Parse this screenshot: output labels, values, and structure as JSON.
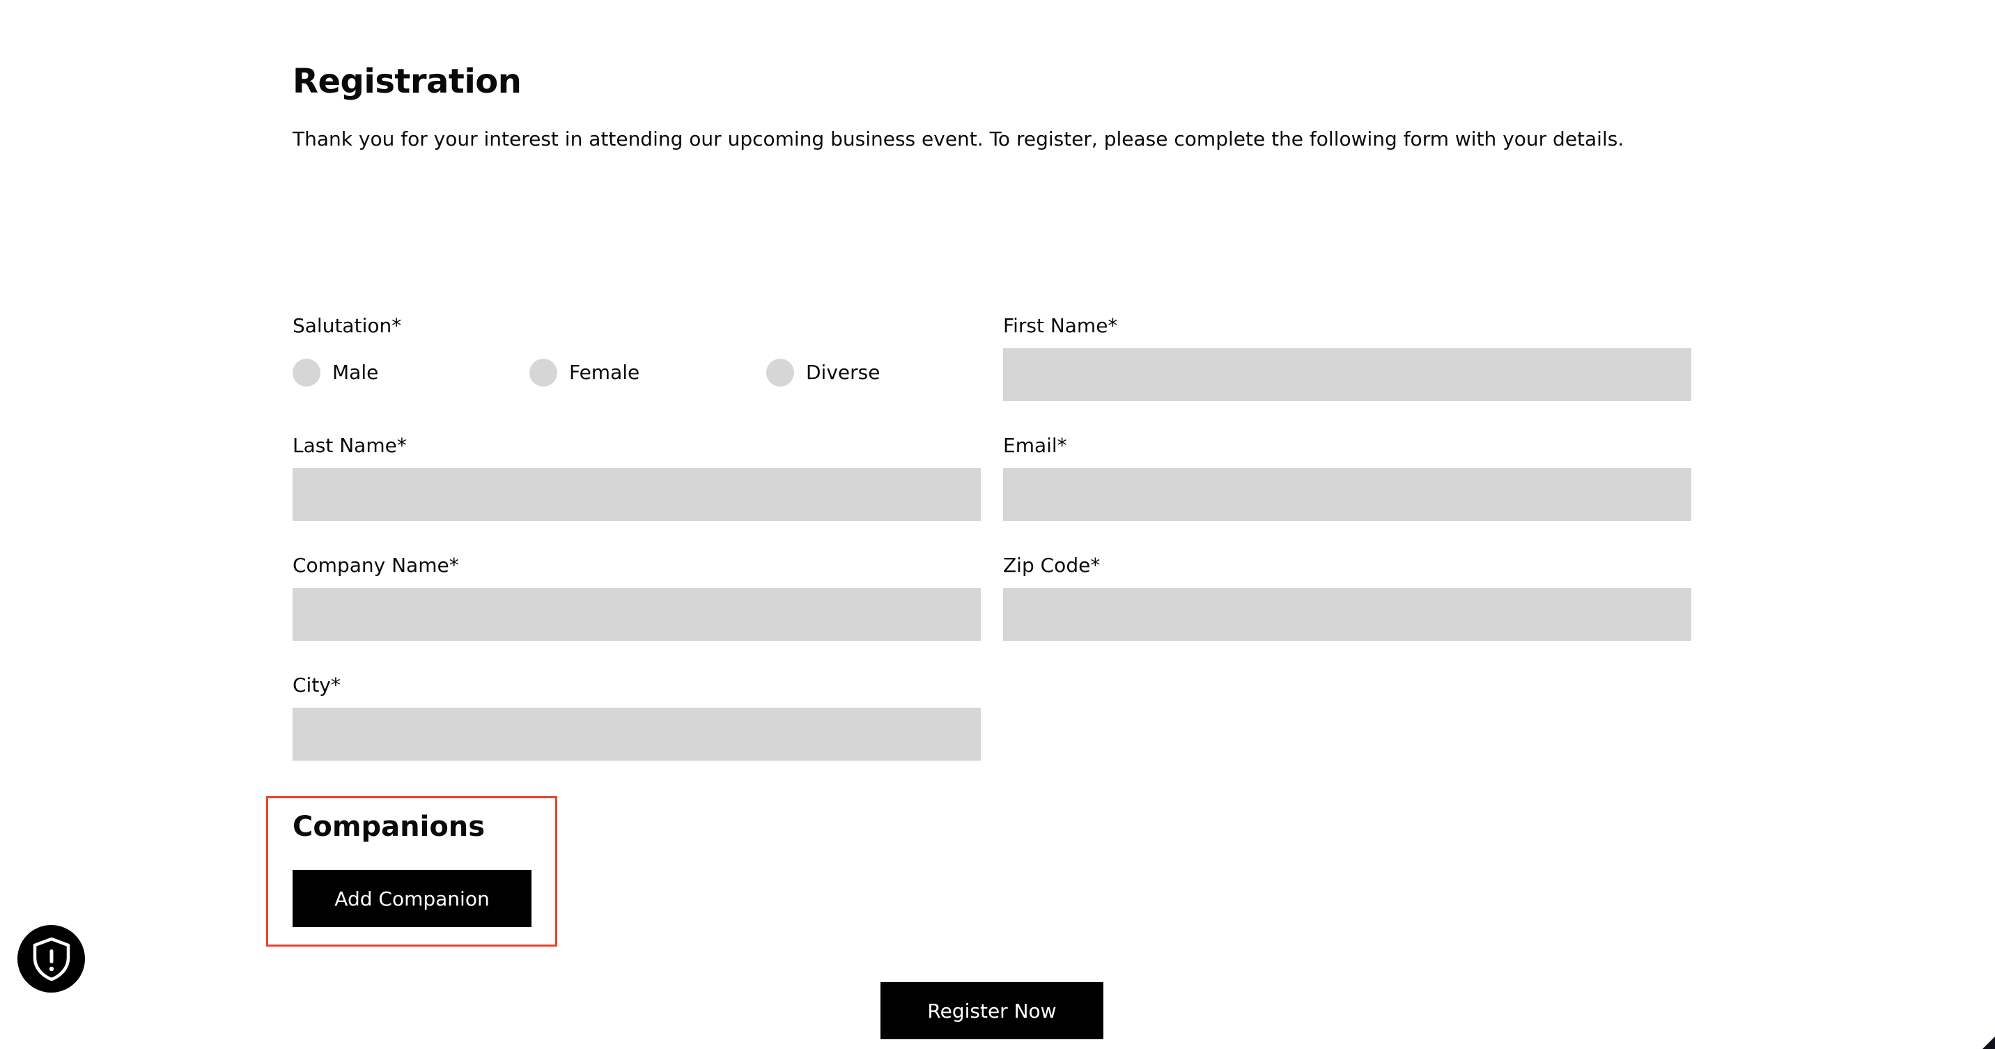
{
  "header": {
    "title": "Registration",
    "intro": "Thank you for your interest in attending our upcoming business event. To register, please complete the following form with your details."
  },
  "form": {
    "salutation": {
      "label": "Salutation*",
      "options": [
        "Male",
        "Female",
        "Diverse"
      ],
      "selected": null
    },
    "first_name": {
      "label": "First Name*",
      "value": "",
      "placeholder": ""
    },
    "last_name": {
      "label": "Last Name*",
      "value": "",
      "placeholder": ""
    },
    "email": {
      "label": "Email*",
      "value": "",
      "placeholder": ""
    },
    "company_name": {
      "label": "Company Name*",
      "value": "",
      "placeholder": ""
    },
    "zip_code": {
      "label": "Zip Code*",
      "value": "",
      "placeholder": ""
    },
    "city": {
      "label": "City*",
      "value": "",
      "placeholder": ""
    }
  },
  "companions": {
    "title": "Companions",
    "add_button_label": "Add Companion"
  },
  "actions": {
    "register_label": "Register Now"
  },
  "icons": {
    "privacy_widget": "shield-alert-icon"
  },
  "colors": {
    "input_background": "#d6d6d6",
    "button_background": "#000000",
    "button_text": "#ffffff",
    "highlight_border": "#e8432f"
  }
}
